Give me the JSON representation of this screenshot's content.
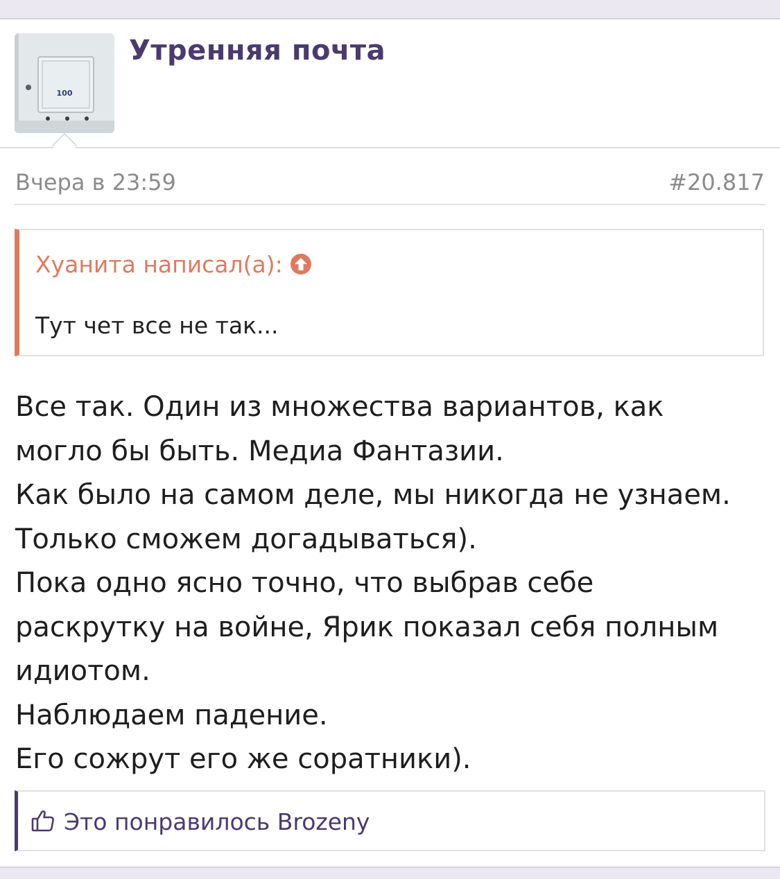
{
  "post": {
    "username": "Утренняя почта",
    "avatar_label": "100",
    "date": "Вчера в 23:59",
    "number": "#20.817",
    "accent_color": "#4a3a6e",
    "quote_color": "#e07a5f"
  },
  "quote": {
    "author": "Хуанита написал(а):",
    "jump_icon": "arrow-up-circle-icon",
    "text": "Тут чет все не так..."
  },
  "message": {
    "lines": [
      "Все так. Один из множества вариантов, как",
      "могло бы быть. Медиа Фантазии.",
      "Как было на самом деле, мы никогда не узнаем.",
      "Только сможем догадываться).",
      "Пока одно ясно точно, что выбрав себе",
      "раскрутку на войне, Ярик показал себя полным",
      "идиотом.",
      "Наблюдаем падение.",
      "Его сожрут его же соратники)."
    ]
  },
  "likes": {
    "icon": "thumbs-up-icon",
    "text": "Это понравилось Brozeny"
  }
}
